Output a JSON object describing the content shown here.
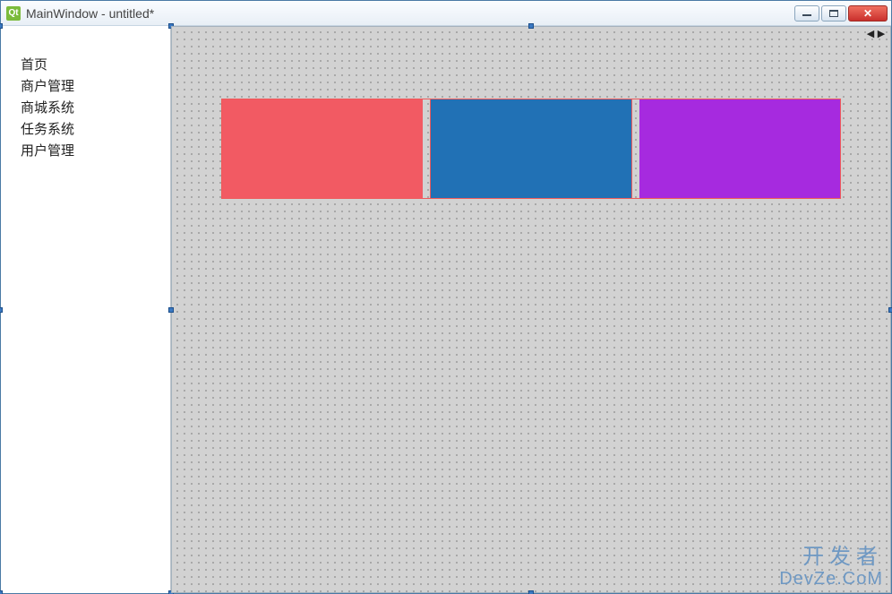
{
  "window": {
    "icon_label": "Qt",
    "title": "MainWindow - untitled*"
  },
  "sidebar": {
    "items": [
      {
        "label": "首页"
      },
      {
        "label": "商户管理"
      },
      {
        "label": "商城系统"
      },
      {
        "label": "任务系统"
      },
      {
        "label": "用户管理"
      }
    ]
  },
  "tab_scroll": {
    "left": "◀",
    "right": "▶"
  },
  "blocks": [
    {
      "name": "red-block",
      "color": "#f25a63"
    },
    {
      "name": "blue-block",
      "color": "#2171b5"
    },
    {
      "name": "purple-block",
      "color": "#a62adf"
    }
  ],
  "watermark": {
    "line1": "开发者",
    "line2": "DevZe.CoM"
  }
}
